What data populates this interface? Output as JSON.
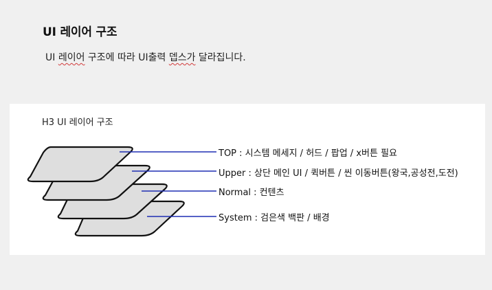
{
  "header": {
    "title": "UI 레이어 구조",
    "description_parts": [
      "UI ",
      "레이어",
      " 구조에 따라 UI출력 ",
      "뎁스가",
      " 달라집니다."
    ]
  },
  "diagram": {
    "title": "H3 UI 레이어 구조",
    "layers": [
      {
        "id": "top",
        "label": "TOP : 시스템 메세지 / 허드 / 팝업 / x버튼 필요"
      },
      {
        "id": "upper",
        "label": "Upper : 상단 메인 UI / 퀵버튼 / 씬 이동버튼(왕국,공성전,도전)"
      },
      {
        "id": "normal",
        "label": "Normal : 컨텐츠"
      },
      {
        "id": "system",
        "label": "System : 검은색 백판 / 배경"
      }
    ],
    "colors": {
      "layer_fill": "#dedede",
      "layer_stroke": "#111111",
      "connector": "#1f2fb3",
      "panel_bg": "#ffffff",
      "page_bg": "#f0f0f0"
    }
  }
}
